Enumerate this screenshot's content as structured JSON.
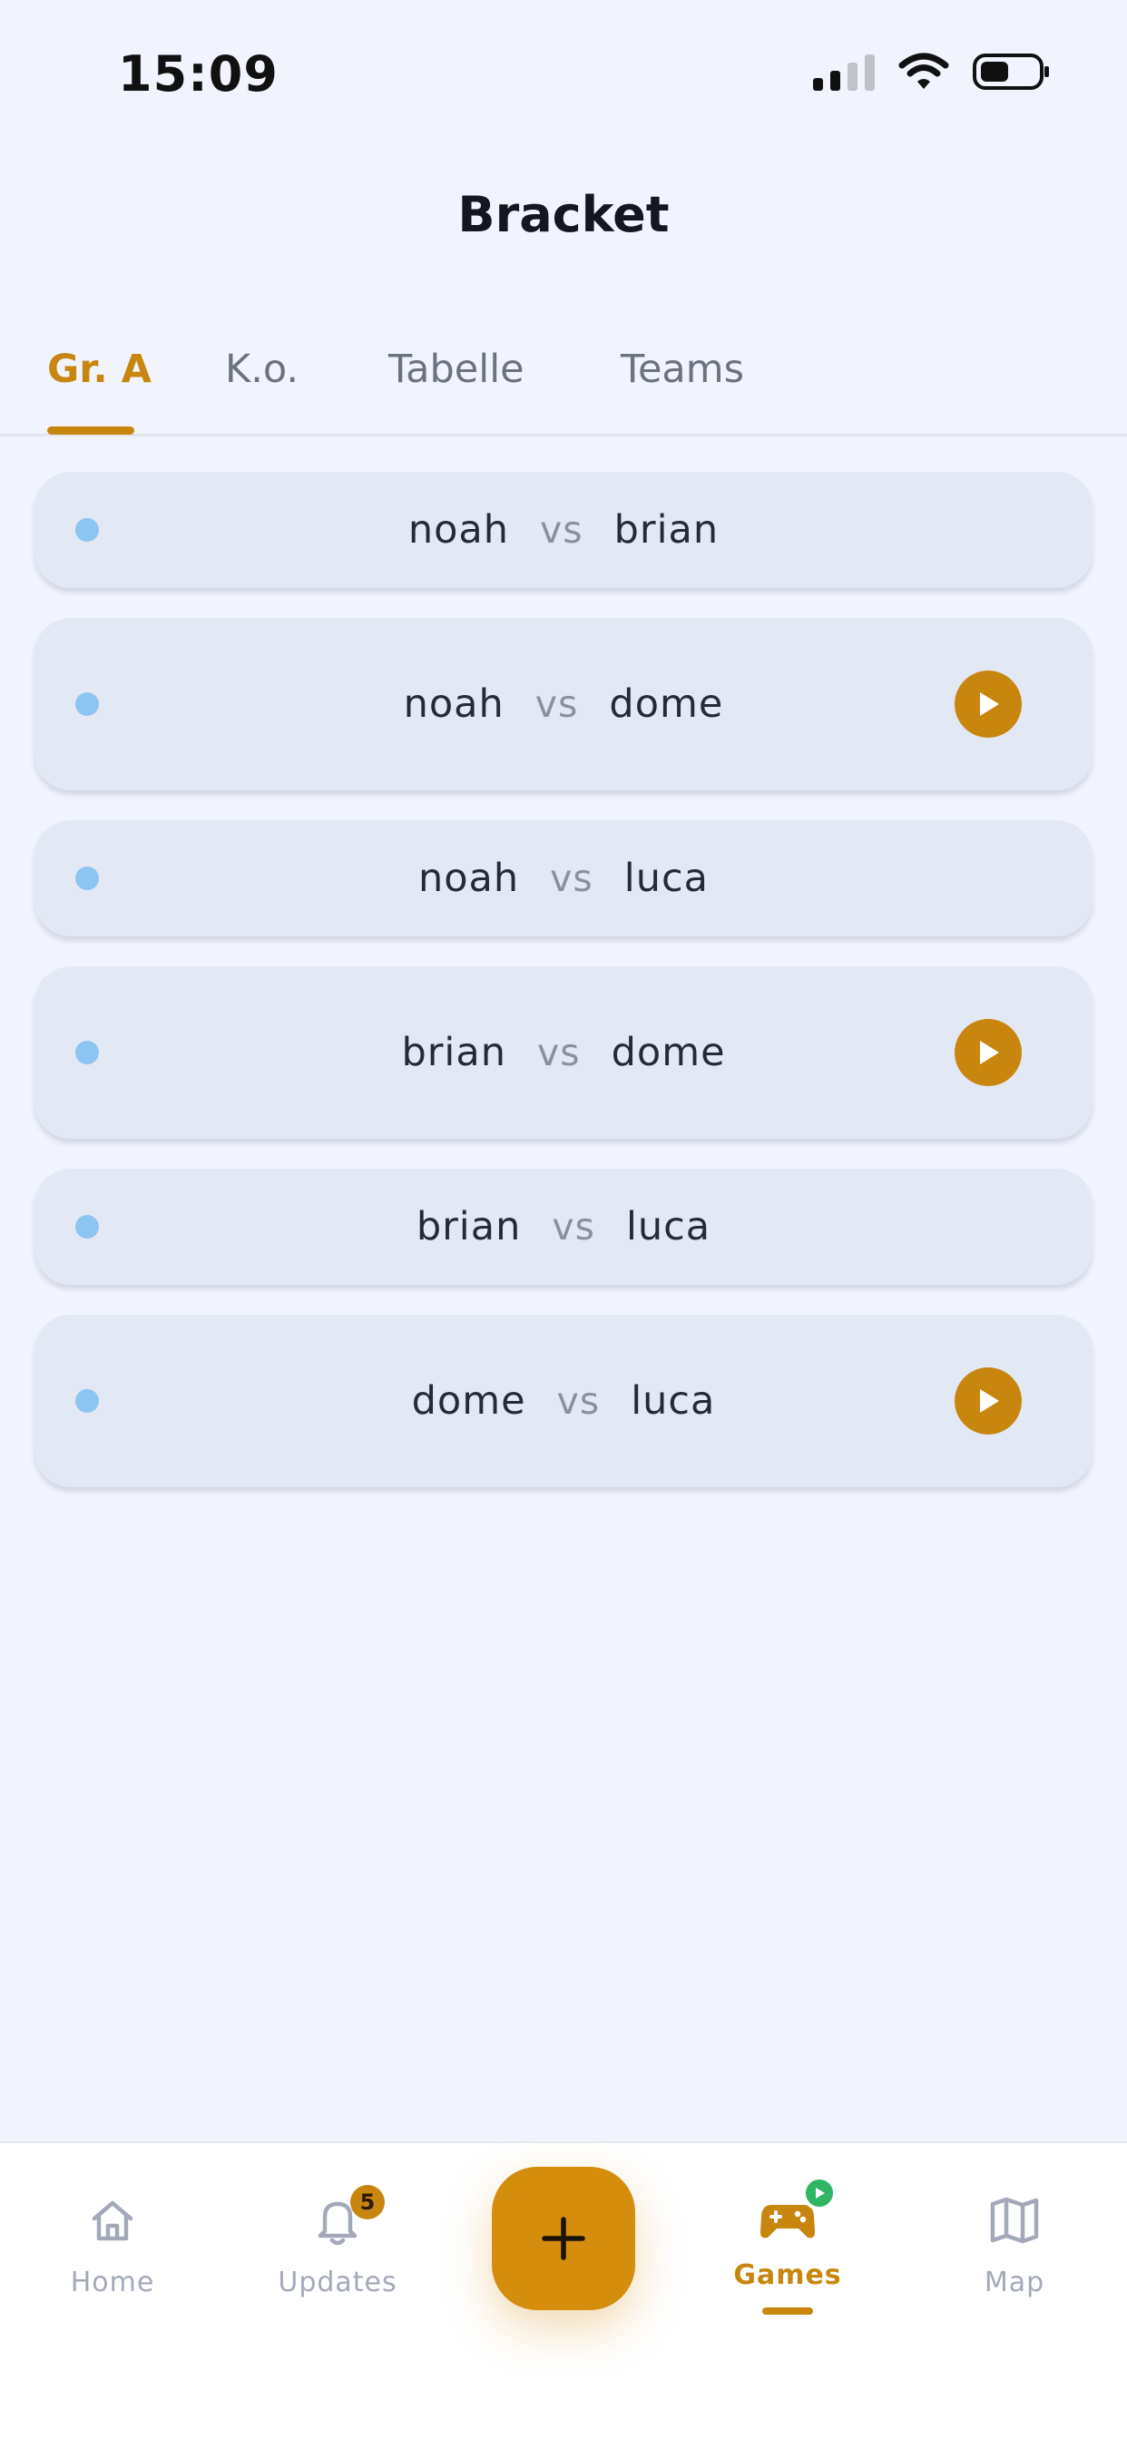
{
  "status_bar": {
    "time": "15:09"
  },
  "header": {
    "title": "Bracket"
  },
  "tabs": [
    {
      "label": "Gr. A",
      "active": true
    },
    {
      "label": "K.o.",
      "active": false
    },
    {
      "label": "Tabelle",
      "active": false
    },
    {
      "label": "Teams",
      "active": false
    }
  ],
  "matches": [
    {
      "home": "noah",
      "vs": "vs",
      "away": "brian",
      "playable": false
    },
    {
      "home": "noah",
      "vs": "vs",
      "away": "dome",
      "playable": true
    },
    {
      "home": "noah",
      "vs": "vs",
      "away": "luca",
      "playable": false
    },
    {
      "home": "brian",
      "vs": "vs",
      "away": "dome",
      "playable": true
    },
    {
      "home": "brian",
      "vs": "vs",
      "away": "luca",
      "playable": false
    },
    {
      "home": "dome",
      "vs": "vs",
      "away": "luca",
      "playable": true
    }
  ],
  "bottom_nav": {
    "home_label": "Home",
    "updates_label": "Updates",
    "updates_badge": "5",
    "games_label": "Games",
    "map_label": "Map",
    "fab_icon": "plus-icon"
  },
  "colors": {
    "accent": "#c8860f",
    "background": "#f1f4fd",
    "card": "#e3e8f5",
    "dot": "#8cc4f2",
    "live": "#2fb563"
  }
}
